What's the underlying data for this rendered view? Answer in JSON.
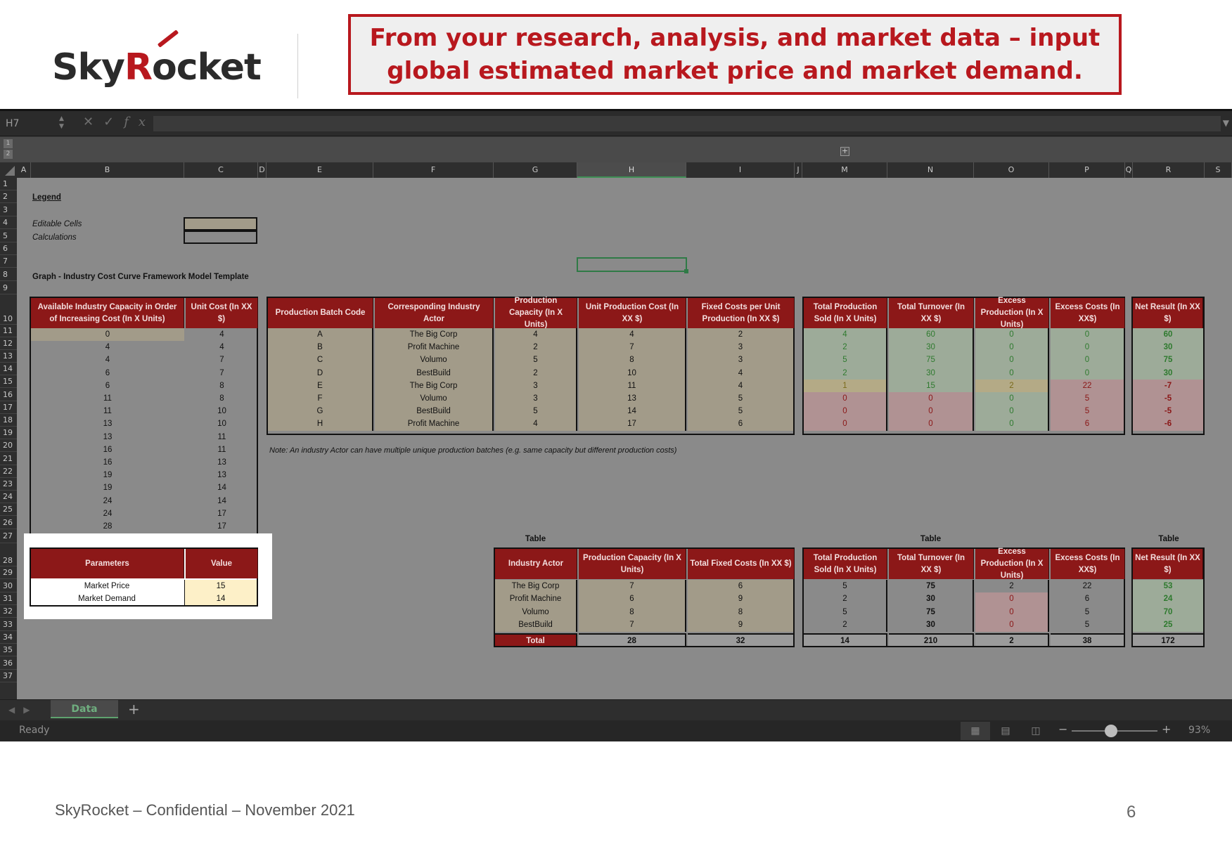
{
  "slide": {
    "logo_text_a": "Sky",
    "logo_text_r": "R",
    "logo_text_b": "ocket",
    "callout": "From your research, analysis, and market data – input global estimated market price and market demand.",
    "footer": "SkyRocket – Confidential – November 2021",
    "page_number": "6"
  },
  "excel": {
    "name_box": "H7",
    "fx": "fx",
    "columns": [
      "A",
      "B",
      "C",
      "D",
      "E",
      "F",
      "G",
      "H",
      "I",
      "J",
      "M",
      "N",
      "O",
      "P",
      "Q",
      "R",
      "S"
    ],
    "rows": [
      "1",
      "2",
      "3",
      "4",
      "5",
      "6",
      "7",
      "8",
      "9",
      "10",
      "11",
      "12",
      "13",
      "14",
      "15",
      "16",
      "17",
      "18",
      "19",
      "20",
      "21",
      "22",
      "23",
      "24",
      "25",
      "26",
      "27",
      "28",
      "29",
      "30",
      "31",
      "32",
      "33",
      "34",
      "35",
      "36",
      "37"
    ],
    "sheet_tab": "Data",
    "status": "Ready",
    "zoom": "93%",
    "outline_levels": [
      "1",
      "2"
    ]
  },
  "sheet": {
    "legend_title": "Legend",
    "editable_label": "Editable Cells",
    "calc_label": "Calculations",
    "graph_title": "Graph - Industry Cost Curve Framework Model Template",
    "note": "Note: An industry Actor can have multiple unique production batches (e.g. same capacity but different production costs)",
    "cap_table": {
      "headers": [
        "Available Industry Capacity in Order of Increasing Cost (In X Units)",
        "Unit Cost (In XX $)"
      ],
      "rows": [
        [
          "0",
          "4"
        ],
        [
          "4",
          "4"
        ],
        [
          "4",
          "7"
        ],
        [
          "6",
          "7"
        ],
        [
          "6",
          "8"
        ],
        [
          "11",
          "8"
        ],
        [
          "11",
          "10"
        ],
        [
          "13",
          "10"
        ],
        [
          "13",
          "11"
        ],
        [
          "16",
          "11"
        ],
        [
          "16",
          "13"
        ],
        [
          "19",
          "13"
        ],
        [
          "19",
          "14"
        ],
        [
          "24",
          "14"
        ],
        [
          "24",
          "17"
        ],
        [
          "28",
          "17"
        ]
      ]
    },
    "batch_table": {
      "headers": [
        "Production Batch Code",
        "Corresponding Industry Actor",
        "Production Capacity (In X Units)",
        "Unit Production Cost (In XX $)",
        "Fixed Costs per Unit Production (In XX $)"
      ],
      "rows": [
        [
          "A",
          "The Big Corp",
          "4",
          "4",
          "2"
        ],
        [
          "B",
          "Profit Machine",
          "2",
          "7",
          "3"
        ],
        [
          "C",
          "Volumo",
          "5",
          "8",
          "3"
        ],
        [
          "D",
          "BestBuild",
          "2",
          "10",
          "4"
        ],
        [
          "E",
          "The Big Corp",
          "3",
          "11",
          "4"
        ],
        [
          "F",
          "Volumo",
          "3",
          "13",
          "5"
        ],
        [
          "G",
          "BestBuild",
          "5",
          "14",
          "5"
        ],
        [
          "H",
          "Profit Machine",
          "4",
          "17",
          "6"
        ]
      ]
    },
    "result_table": {
      "headers": [
        "Total Production Sold (In X Units)",
        "Total Turnover (In XX $)",
        "Excess Production (In X Units)",
        "Excess Costs (In XX$)"
      ],
      "rows": [
        [
          "4",
          "60",
          "0",
          "0"
        ],
        [
          "2",
          "30",
          "0",
          "0"
        ],
        [
          "5",
          "75",
          "0",
          "0"
        ],
        [
          "2",
          "30",
          "0",
          "0"
        ],
        [
          "1",
          "15",
          "2",
          "22"
        ],
        [
          "0",
          "0",
          "0",
          "5"
        ],
        [
          "0",
          "0",
          "0",
          "5"
        ],
        [
          "0",
          "0",
          "0",
          "6"
        ]
      ]
    },
    "net_table": {
      "header": "Net Result (In XX $)",
      "rows": [
        "60",
        "30",
        "75",
        "30",
        "-7",
        "-5",
        "-5",
        "-6"
      ]
    },
    "params_table": {
      "headers": [
        "Parameters",
        "Value"
      ],
      "rows": [
        [
          "Market Price",
          "15"
        ],
        [
          "Market Demand",
          "14"
        ]
      ]
    },
    "table_label": "Table",
    "actor_table": {
      "headers": [
        "Industry Actor",
        "Production Capacity (In X Units)",
        "Total Fixed Costs (In XX $)"
      ],
      "rows": [
        [
          "The Big Corp",
          "7",
          "6"
        ],
        [
          "Profit Machine",
          "6",
          "9"
        ],
        [
          "Volumo",
          "8",
          "8"
        ],
        [
          "BestBuild",
          "7",
          "9"
        ]
      ],
      "total": [
        "Total",
        "28",
        "32"
      ]
    },
    "actor_result_table": {
      "headers": [
        "Total Production Sold (In X Units)",
        "Total Turnover (In XX $)",
        "Excess Production (In X Units)",
        "Excess Costs (In XX$)"
      ],
      "rows": [
        [
          "5",
          "75",
          "2",
          "22"
        ],
        [
          "2",
          "30",
          "0",
          "6"
        ],
        [
          "5",
          "75",
          "0",
          "5"
        ],
        [
          "2",
          "30",
          "0",
          "5"
        ]
      ],
      "total": [
        "14",
        "210",
        "2",
        "38"
      ]
    },
    "actor_net_table": {
      "header": "Net Result (In XX $)",
      "rows": [
        "53",
        "24",
        "70",
        "25"
      ],
      "total": "172"
    }
  }
}
